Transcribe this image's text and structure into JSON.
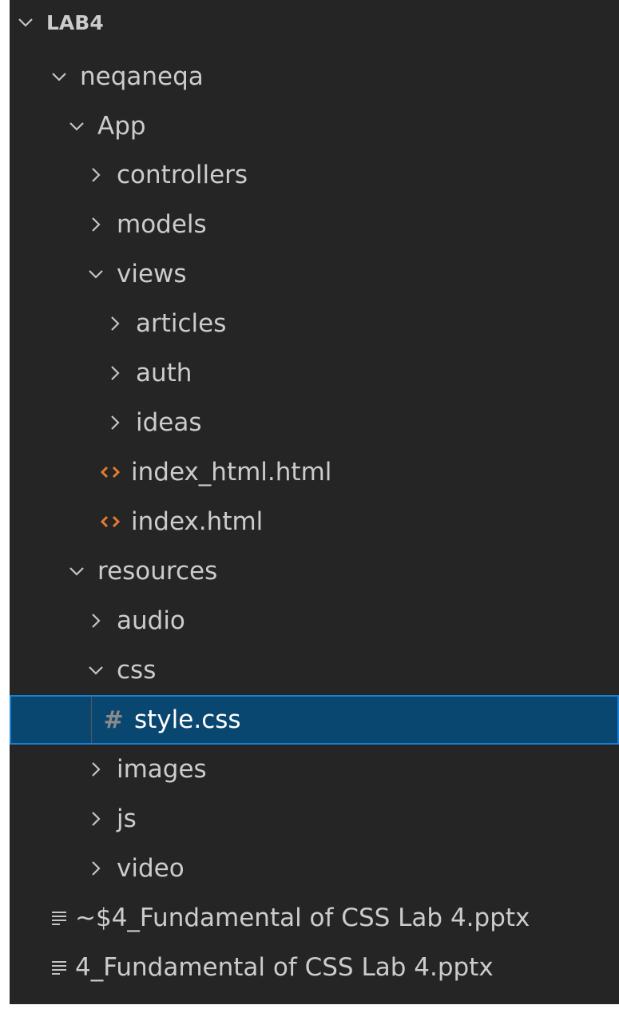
{
  "explorer": {
    "root": {
      "label": "LAB4",
      "expanded": true
    },
    "items": [
      {
        "label": "neqaneqa",
        "type": "folder",
        "expanded": true
      },
      {
        "label": "App",
        "type": "folder",
        "expanded": true
      },
      {
        "label": "controllers",
        "type": "folder",
        "expanded": false
      },
      {
        "label": "models",
        "type": "folder",
        "expanded": false
      },
      {
        "label": "views",
        "type": "folder",
        "expanded": true
      },
      {
        "label": "articles",
        "type": "folder",
        "expanded": false
      },
      {
        "label": "auth",
        "type": "folder",
        "expanded": false
      },
      {
        "label": "ideas",
        "type": "folder",
        "expanded": false
      },
      {
        "label": "index_html.html",
        "type": "file",
        "icon": "html-file-icon"
      },
      {
        "label": "index.html",
        "type": "file",
        "icon": "html-file-icon"
      },
      {
        "label": "resources",
        "type": "folder",
        "expanded": true
      },
      {
        "label": "audio",
        "type": "folder",
        "expanded": false
      },
      {
        "label": "css",
        "type": "folder",
        "expanded": true
      },
      {
        "label": "style.css",
        "type": "file",
        "icon": "css-hash-icon",
        "selected": true,
        "glyph": "#"
      },
      {
        "label": "images",
        "type": "folder",
        "expanded": false
      },
      {
        "label": "js",
        "type": "folder",
        "expanded": false
      },
      {
        "label": "video",
        "type": "folder",
        "expanded": false
      },
      {
        "label": "~$4_Fundamental of CSS Lab 4.pptx",
        "type": "file",
        "icon": "text-file-icon"
      },
      {
        "label": "4_Fundamental of CSS Lab 4.pptx",
        "type": "file",
        "icon": "text-file-icon"
      }
    ]
  },
  "colors": {
    "sidebar_background": "#252526",
    "text": "#cccccc",
    "html_icon": "#e37933",
    "selected_background": "#094771",
    "selected_border": "#1a7fd4"
  }
}
